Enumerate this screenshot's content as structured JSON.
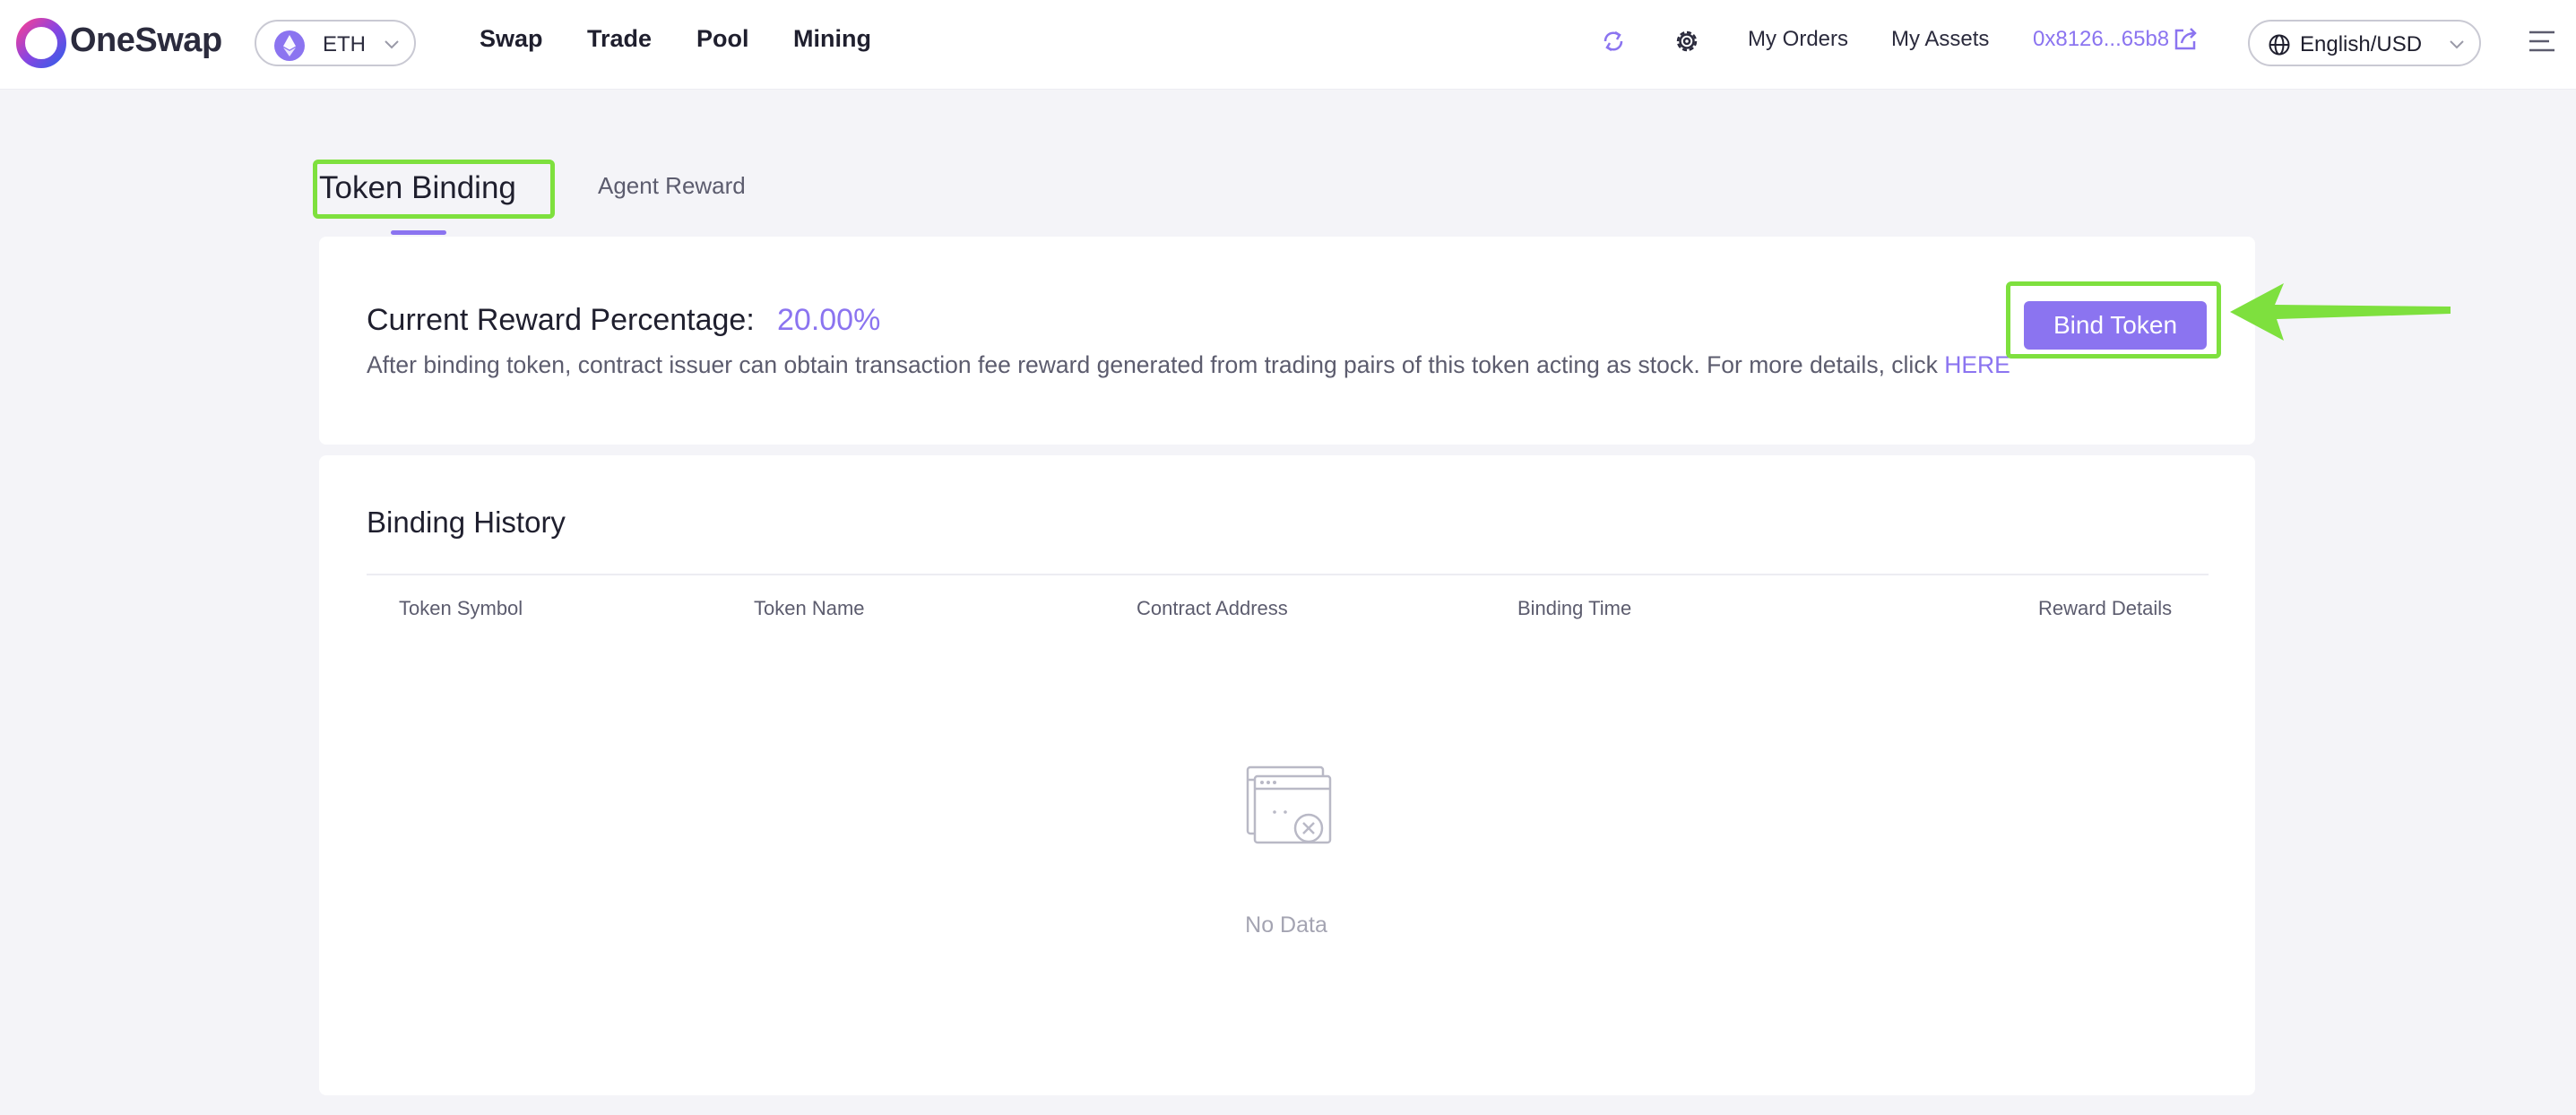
{
  "header": {
    "logo_text": "OneSwap",
    "chain": "ETH",
    "nav": [
      "Swap",
      "Trade",
      "Pool",
      "Mining"
    ],
    "my_orders": "My Orders",
    "my_assets": "My Assets",
    "wallet_address": "0x8126...65b8",
    "language": "English/USD"
  },
  "tabs": {
    "active": "Token Binding",
    "inactive": "Agent Reward"
  },
  "reward": {
    "title": "Current Reward Percentage:",
    "value": "20.00%",
    "description": "After binding token, contract issuer can obtain transaction fee reward generated from trading pairs of this token acting as stock. For more details, click",
    "link_text": "HERE",
    "bind_button": "Bind Token"
  },
  "history": {
    "title": "Binding History",
    "columns": [
      "Token Symbol",
      "Token Name",
      "Contract Address",
      "Binding Time",
      "Reward Details"
    ],
    "rows": [],
    "empty_text": "No Data"
  },
  "colors": {
    "accent": "#8b74f0",
    "highlight": "#7ee03e"
  }
}
